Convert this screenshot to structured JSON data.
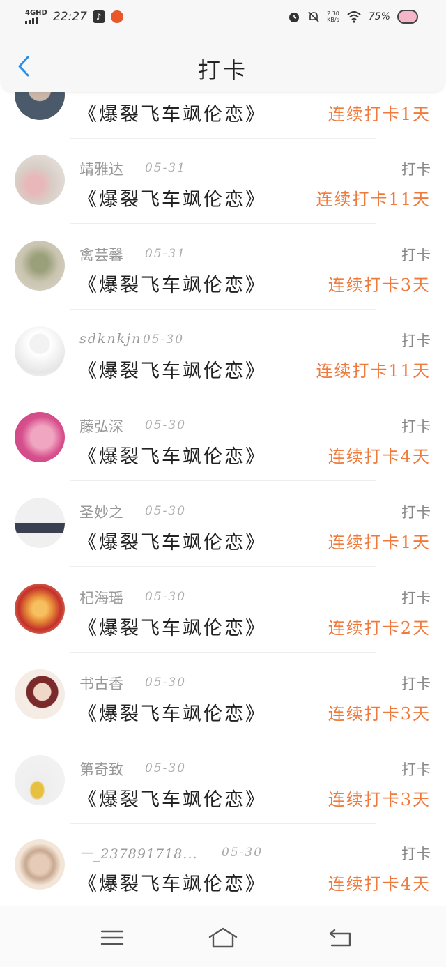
{
  "status_bar": {
    "network": "4GHD",
    "time": "22:27",
    "net_speed_value": "2.30",
    "net_speed_unit": "KB/s",
    "battery": "75%"
  },
  "header": {
    "title": "打卡"
  },
  "rows": [
    {
      "name": "",
      "date": "",
      "label": "",
      "book": "《爆裂飞车飒伦恋》",
      "streak": "连续打卡1天",
      "avatar_colors": [
        "#4a5a6a",
        "#c9b6a8"
      ]
    },
    {
      "name": "靖雅达",
      "date": "05-31",
      "label": "打卡",
      "book": "《爆裂飞车飒伦恋》",
      "streak": "连续打卡11天",
      "avatar_colors": [
        "#d8cfc8",
        "#e8b8b8"
      ]
    },
    {
      "name": "禽芸馨",
      "date": "05-31",
      "label": "打卡",
      "book": "《爆裂飞车飒伦恋》",
      "streak": "连续打卡3天",
      "avatar_colors": [
        "#c9c4b0",
        "#9aa07a"
      ]
    },
    {
      "name": "sdknkjn",
      "date": "05-30",
      "label": "打卡",
      "book": "《爆裂飞车飒伦恋》",
      "streak": "连续打卡11天",
      "avatar_colors": [
        "#ffffff",
        "#e0e0e0"
      ]
    },
    {
      "name": "藤弘深",
      "date": "05-30",
      "label": "打卡",
      "book": "《爆裂飞车飒伦恋》",
      "streak": "连续打卡4天",
      "avatar_colors": [
        "#d7508e",
        "#f0a5c0"
      ]
    },
    {
      "name": "圣妙之",
      "date": "05-30",
      "label": "打卡",
      "book": "《爆裂飞车飒伦恋》",
      "streak": "连续打卡1天",
      "avatar_colors": [
        "#f0f0f0",
        "#3a4050"
      ]
    },
    {
      "name": "杞海瑶",
      "date": "05-30",
      "label": "打卡",
      "book": "《爆裂飞车飒伦恋》",
      "streak": "连续打卡2天",
      "avatar_colors": [
        "#e8903a",
        "#c4302a"
      ]
    },
    {
      "name": "书古香",
      "date": "05-30",
      "label": "打卡",
      "book": "《爆裂飞车飒伦恋》",
      "streak": "连续打卡3天",
      "avatar_colors": [
        "#f5ece6",
        "#7a2a2a"
      ]
    },
    {
      "name": "第奇致",
      "date": "05-30",
      "label": "打卡",
      "book": "《爆裂飞车飒伦恋》",
      "streak": "连续打卡3天",
      "avatar_colors": [
        "#eeeeee",
        "#e8c040"
      ]
    },
    {
      "name": "一_237891718...",
      "date": "05-30",
      "label": "打卡",
      "book": "《爆裂飞车飒伦恋》",
      "streak": "连续打卡4天",
      "avatar_colors": [
        "#f3e6d8",
        "#c8a890"
      ]
    }
  ],
  "colors": {
    "accent": "#ef7a3c",
    "back_arrow": "#2b8fe6"
  }
}
